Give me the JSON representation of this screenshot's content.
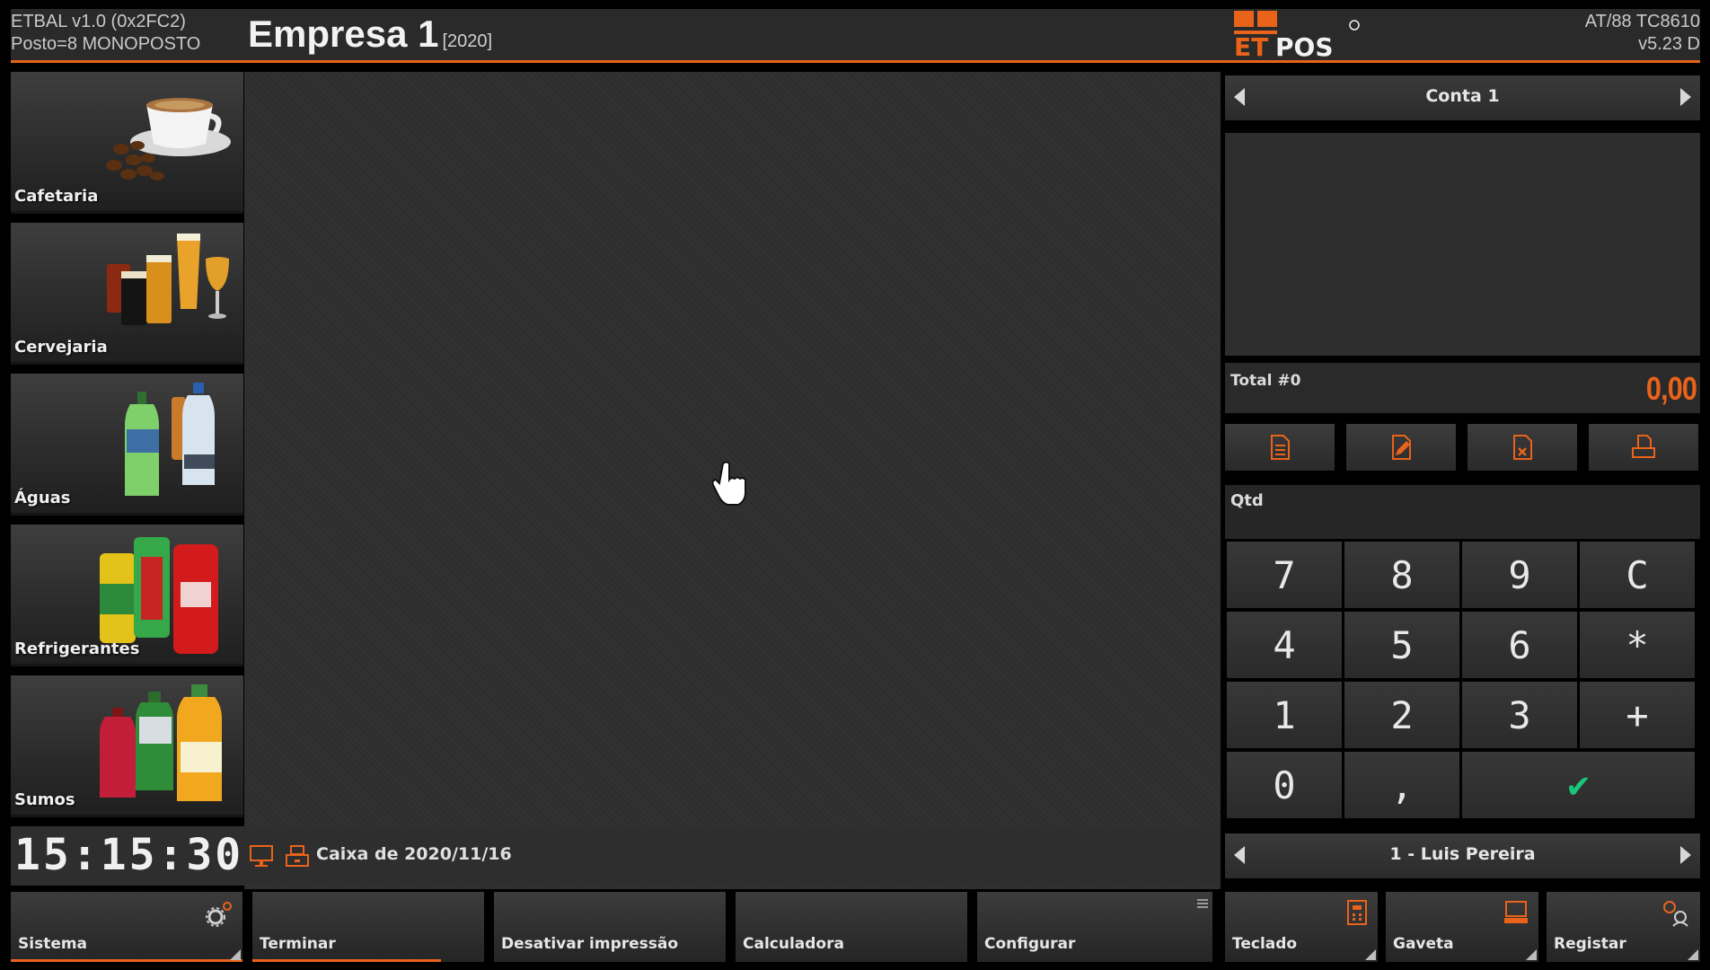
{
  "header": {
    "system_line1": "ETBAL v1.0 (0x2FC2)",
    "system_line2": "Posto=8 MONOPOSTO",
    "company": "Empresa 1",
    "year": "[2020]",
    "logo_text": "ETPOS",
    "version_line1": "AT/88 TC8610",
    "version_line2": "v5.23 D"
  },
  "categories": [
    {
      "label": "Cafetaria",
      "icon": "coffee-cup-image"
    },
    {
      "label": "Cervejaria",
      "icon": "beer-glasses-image"
    },
    {
      "label": "Águas",
      "icon": "water-bottles-image"
    },
    {
      "label": "Refrigerantes",
      "icon": "soda-cans-image"
    },
    {
      "label": "Sumos",
      "icon": "juice-bottles-image"
    }
  ],
  "status": {
    "clock": "15:15:30",
    "caixa": "Caixa de 2020/11/16"
  },
  "account": {
    "title": "Conta 1",
    "total_label": "Total #0",
    "total_value": "0,00"
  },
  "document_buttons": [
    "document-list-icon",
    "edit-document-icon",
    "delete-document-icon",
    "print-document-icon"
  ],
  "qtd_label": "Qtd",
  "keypad": {
    "keys": [
      "7",
      "8",
      "9",
      "C",
      "4",
      "5",
      "6",
      "*",
      "1",
      "2",
      "3",
      "+",
      "0",
      ",",
      "✔"
    ]
  },
  "operator": "1 - Luis Pereira",
  "toolbar": {
    "sistema": "Sistema",
    "terminar": "Terminar",
    "desativar": "Desativar impressão",
    "calculadora": "Calculadora",
    "configurar": "Configurar",
    "teclado": "Teclado",
    "gaveta": "Gaveta",
    "registar": "Registar"
  },
  "colors": {
    "accent": "#e9631a",
    "ok_green": "#19c77b",
    "panel": "#2e2e2e"
  }
}
